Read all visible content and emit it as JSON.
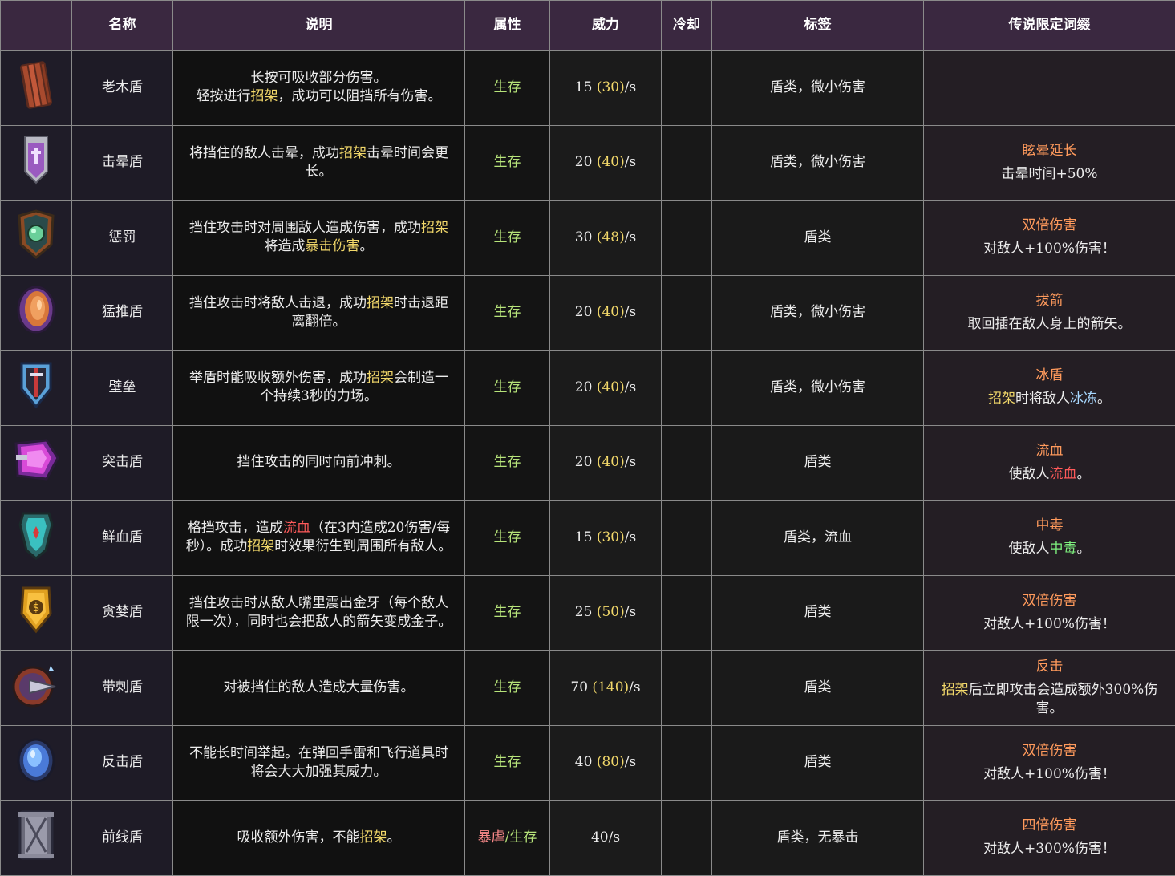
{
  "headers": [
    "",
    "名称",
    "说明",
    "属性",
    "威力",
    "冷却",
    "标签",
    "传说限定词缀"
  ],
  "rows": [
    {
      "icon": "wooden-shield-icon",
      "name": "老木盾",
      "desc": [
        {
          "t": "长按可吸收部分伤害。"
        },
        {
          "br": true
        },
        {
          "t": "轻按进行"
        },
        {
          "t": "招架",
          "c": "yellow"
        },
        {
          "t": "，成功可以阻挡所有伤害。"
        }
      ],
      "attr": [
        {
          "t": "生存"
        }
      ],
      "power_base": "15",
      "power_paren": "30",
      "power_unit": "/s",
      "cooldown": "",
      "tags": "盾类，微小伤害",
      "affix_title": "",
      "affix_desc": []
    },
    {
      "icon": "stun-shield-icon",
      "name": "击晕盾",
      "desc": [
        {
          "t": "将挡住的敌人击晕，成功"
        },
        {
          "t": "招架",
          "c": "yellow"
        },
        {
          "t": "击晕时间会更长。"
        }
      ],
      "attr": [
        {
          "t": "生存"
        }
      ],
      "power_base": "20",
      "power_paren": "40",
      "power_unit": "/s",
      "cooldown": "",
      "tags": "盾类，微小伤害",
      "affix_title": "眩晕延长",
      "affix_desc": [
        {
          "t": "击晕时间+50%"
        }
      ]
    },
    {
      "icon": "punishment-shield-icon",
      "name": "惩罚",
      "desc": [
        {
          "t": "挡住攻击时对周围敌人造成伤害，成功"
        },
        {
          "t": "招架",
          "c": "yellow"
        },
        {
          "t": "将造成"
        },
        {
          "t": "暴击伤害",
          "c": "yellow"
        },
        {
          "t": "。"
        }
      ],
      "attr": [
        {
          "t": "生存"
        }
      ],
      "power_base": "30",
      "power_paren": "48",
      "power_unit": "/s",
      "cooldown": "",
      "tags": "盾类",
      "affix_title": "双倍伤害",
      "affix_desc": [
        {
          "t": "对敌人+100%伤害！"
        }
      ]
    },
    {
      "icon": "force-shield-icon",
      "name": "猛推盾",
      "desc": [
        {
          "t": "挡住攻击时将敌人击退，成功"
        },
        {
          "t": "招架",
          "c": "yellow"
        },
        {
          "t": "时击退距离翻倍。"
        }
      ],
      "attr": [
        {
          "t": "生存"
        }
      ],
      "power_base": "20",
      "power_paren": "40",
      "power_unit": "/s",
      "cooldown": "",
      "tags": "盾类，微小伤害",
      "affix_title": "拔箭",
      "affix_desc": [
        {
          "t": "取回插在敌人身上的箭矢。"
        }
      ]
    },
    {
      "icon": "rampart-shield-icon",
      "name": "壁垒",
      "desc": [
        {
          "t": "举盾时能吸收额外伤害，成功"
        },
        {
          "t": "招架",
          "c": "yellow"
        },
        {
          "t": "会制造一个持续3秒的力场。"
        }
      ],
      "attr": [
        {
          "t": "生存"
        }
      ],
      "power_base": "20",
      "power_paren": "40",
      "power_unit": "/s",
      "cooldown": "",
      "tags": "盾类，微小伤害",
      "affix_title": "冰盾",
      "affix_desc": [
        {
          "t": "招架",
          "c": "yellow"
        },
        {
          "t": "时将敌人"
        },
        {
          "t": "冰冻",
          "c": "blue"
        },
        {
          "t": "。"
        }
      ]
    },
    {
      "icon": "assault-shield-icon",
      "name": "突击盾",
      "desc": [
        {
          "t": "挡住攻击的同时向前冲刺。"
        }
      ],
      "attr": [
        {
          "t": "生存"
        }
      ],
      "power_base": "20",
      "power_paren": "40",
      "power_unit": "/s",
      "cooldown": "",
      "tags": "盾类",
      "affix_title": "流血",
      "affix_desc": [
        {
          "t": "使敌人"
        },
        {
          "t": "流血",
          "c": "red"
        },
        {
          "t": "。"
        }
      ]
    },
    {
      "icon": "bloody-shield-icon",
      "name": "鲜血盾",
      "desc": [
        {
          "t": "格挡攻击，造成"
        },
        {
          "t": "流血",
          "c": "red"
        },
        {
          "t": "（在3内造成20伤害/每秒）。成功"
        },
        {
          "t": "招架",
          "c": "yellow"
        },
        {
          "t": "时效果衍生到周围所有敌人。"
        }
      ],
      "attr": [
        {
          "t": "生存"
        }
      ],
      "power_base": "15",
      "power_paren": "30",
      "power_unit": "/s",
      "cooldown": "",
      "tags": "盾类，流血",
      "affix_title": "中毒",
      "affix_desc": [
        {
          "t": "使敌人"
        },
        {
          "t": "中毒",
          "c": "green"
        },
        {
          "t": "。"
        }
      ]
    },
    {
      "icon": "greed-shield-icon",
      "name": "贪婪盾",
      "desc": [
        {
          "t": "挡住攻击时从敌人嘴里震出金牙（每个敌人限一次），同时也会把敌人的箭矢变成金子。"
        }
      ],
      "attr": [
        {
          "t": "生存"
        }
      ],
      "power_base": "25",
      "power_paren": "50",
      "power_unit": "/s",
      "cooldown": "",
      "tags": "盾类",
      "affix_title": "双倍伤害",
      "affix_desc": [
        {
          "t": "对敌人+100%伤害！"
        }
      ]
    },
    {
      "icon": "spiked-shield-icon",
      "name": "带刺盾",
      "desc": [
        {
          "t": "对被挡住的敌人造成大量伤害。"
        }
      ],
      "attr": [
        {
          "t": "生存"
        }
      ],
      "power_base": "70",
      "power_paren": "140",
      "power_unit": "/s",
      "cooldown": "",
      "tags": "盾类",
      "affix_title": "反击",
      "affix_desc": [
        {
          "t": "招架",
          "c": "yellow"
        },
        {
          "t": "后立即攻击会造成额外300%伤害。"
        }
      ]
    },
    {
      "icon": "parry-shield-icon",
      "name": "反击盾",
      "desc": [
        {
          "t": "不能长时间举起。在弹回手雷和飞行道具时将会大大加强其威力。"
        }
      ],
      "attr": [
        {
          "t": "生存"
        }
      ],
      "power_base": "40",
      "power_paren": "80",
      "power_unit": "/s",
      "cooldown": "",
      "tags": "盾类",
      "affix_title": "双倍伤害",
      "affix_desc": [
        {
          "t": "对敌人+100%伤害！"
        }
      ]
    },
    {
      "icon": "frontline-shield-icon",
      "name": "前线盾",
      "desc": [
        {
          "t": "吸收额外伤害，不能"
        },
        {
          "t": "招架",
          "c": "yellow"
        },
        {
          "t": "。"
        }
      ],
      "attr": [
        {
          "t": "暴虐",
          "c": "pink"
        },
        {
          "t": "/"
        },
        {
          "t": "生存"
        }
      ],
      "power_base": "40",
      "power_paren": "",
      "power_unit": "/s",
      "cooldown": "",
      "tags": "盾类，无暴击",
      "affix_title": "四倍伤害",
      "affix_desc": [
        {
          "t": "对敌人+300%伤害！"
        }
      ]
    }
  ],
  "colors": {
    "header_bg": "#3a2840",
    "survival_green": "#b7e47a",
    "parry_yellow": "#f2d86a",
    "bleed_red": "#ff5a5a",
    "affix_orange": "#ff9a5c"
  }
}
